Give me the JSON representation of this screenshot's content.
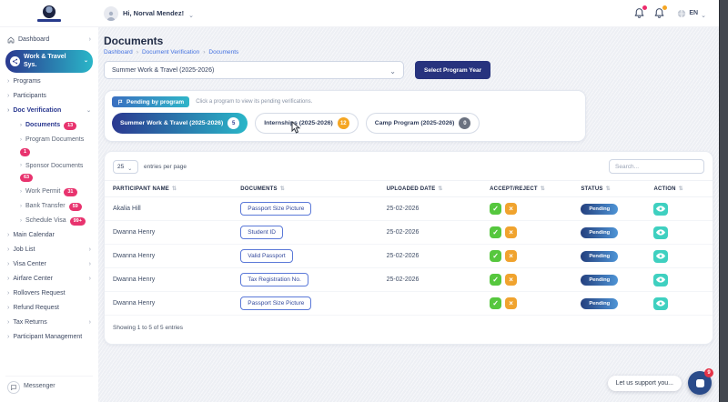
{
  "header": {
    "greeting": "Hi, Norval Mendez!",
    "language": "EN"
  },
  "sidebar": {
    "items": [
      {
        "label": "Dashboard"
      },
      {
        "label": "Work & Travel Sys."
      },
      {
        "label": "Programs"
      },
      {
        "label": "Participants"
      },
      {
        "label": "Doc Verification"
      },
      {
        "label": "Documents",
        "badge": "13"
      },
      {
        "label": "Program Documents",
        "badge": "1"
      },
      {
        "label": "Sponsor Documents",
        "badge": "63"
      },
      {
        "label": "Work Permit",
        "badge": "31"
      },
      {
        "label": "Bank Transfer",
        "badge": "59"
      },
      {
        "label": "Schedule Visa",
        "badge": "99+"
      },
      {
        "label": "Main Calendar"
      },
      {
        "label": "Job List"
      },
      {
        "label": "Visa Center"
      },
      {
        "label": "Airfare Center"
      },
      {
        "label": "Rollovers Request"
      },
      {
        "label": "Refund Request"
      },
      {
        "label": "Tax Returns"
      },
      {
        "label": "Participant Management"
      },
      {
        "label": "Messenger"
      }
    ]
  },
  "page": {
    "title": "Documents",
    "breadcrumb": [
      "Dashboard",
      "Document Verification",
      "Documents"
    ],
    "program_select": "Summer Work & Travel (2025-2026)",
    "select_button": "Select Program Year"
  },
  "pending_card": {
    "badge": "Pending by program",
    "hint": "Click a program to view its pending verifications.",
    "tabs": [
      {
        "label": "Summer Work & Travel (2025-2026)",
        "count": "5"
      },
      {
        "label": "Internships (2025-2026)",
        "count": "12"
      },
      {
        "label": "Camp Program (2025-2026)",
        "count": "0"
      }
    ]
  },
  "table": {
    "entries_select": "25",
    "entries_label": "entries per page",
    "search_placeholder": "Search...",
    "columns": [
      "PARTICIPANT NAME",
      "DOCUMENTS",
      "UPLOADED DATE",
      "ACCEPT/REJECT",
      "STATUS",
      "ACTION"
    ],
    "rows": [
      {
        "name": "Akalia Hill",
        "document": "Passport Size Picture",
        "date": "25-02-2026",
        "status": "Pending"
      },
      {
        "name": "Dwanna Henry",
        "document": "Student ID",
        "date": "25-02-2026",
        "status": "Pending"
      },
      {
        "name": "Dwanna Henry",
        "document": "Valid Passport",
        "date": "25-02-2026",
        "status": "Pending"
      },
      {
        "name": "Dwanna Henry",
        "document": "Tax Registration No.",
        "date": "25-02-2026",
        "status": "Pending"
      },
      {
        "name": "Dwanna Henry",
        "document": "Passport Size Picture",
        "date": "",
        "status": "Pending"
      }
    ],
    "footer": "Showing 1 to 5 of 5 entries"
  },
  "support": {
    "label": "Let us support you...",
    "badge": "9"
  },
  "colors": {
    "accent_navy": "#2b3990",
    "accent_teal": "#2ab6c8",
    "button_navy": "#27337e",
    "badge_pink": "#e8336e",
    "success_green": "#56c73e",
    "warning_orange": "#f0a32e",
    "action_teal": "#3fd0c0",
    "status_gradient_start": "#24407e",
    "status_gradient_end": "#4e94d6"
  }
}
